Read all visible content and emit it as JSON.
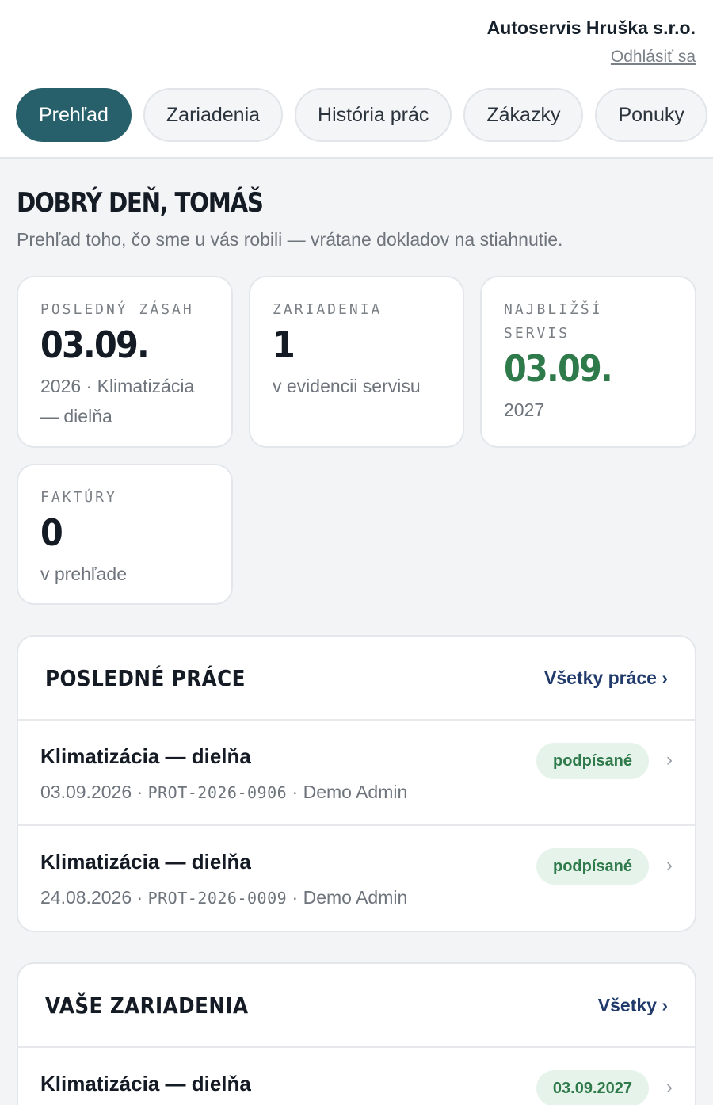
{
  "header": {
    "company": "Autoservis Hruška s.r.o.",
    "logout": "Odhlásiť sa"
  },
  "tabs": [
    {
      "label": "Prehľad",
      "active": true
    },
    {
      "label": "Zariadenia",
      "active": false
    },
    {
      "label": "História prác",
      "active": false
    },
    {
      "label": "Zákazky",
      "active": false
    },
    {
      "label": "Ponuky",
      "active": false
    }
  ],
  "greeting": {
    "title": "DOBRÝ DEŇ, TOMÁŠ",
    "subtitle": "Prehľad toho, čo sme u vás robili — vrátane dokladov na stiahnutie."
  },
  "stats": {
    "last": {
      "label": "POSLEDNÝ ZÁSAH",
      "value": "03.09.",
      "desc": "2026 · Klimatizácia — dielňa"
    },
    "devices": {
      "label": "ZARIADENIA",
      "value": "1",
      "desc": "v evidencii servisu"
    },
    "next": {
      "label": "NAJBLIŽŠÍ SERVIS",
      "value": "03.09.",
      "desc": "2027"
    },
    "invoices": {
      "label": "FAKTÚRY",
      "value": "0",
      "desc": "v prehľade"
    }
  },
  "recent_work": {
    "title": "POSLEDNÉ PRÁCE",
    "link": "Všetky práce ›",
    "rows": [
      {
        "title": "Klimatizácia — dielňa",
        "date": "03.09.2026",
        "code": "PROT-2026-0906",
        "person": "Demo Admin",
        "badge": "podpísané"
      },
      {
        "title": "Klimatizácia — dielňa",
        "date": "24.08.2026",
        "code": "PROT-2026-0009",
        "person": "Demo Admin",
        "badge": "podpísané"
      }
    ]
  },
  "devices_panel": {
    "title": "VAŠE ZARIADENIA",
    "link": "Všetky ›",
    "rows": [
      {
        "title": "Klimatizácia — dielňa",
        "badge": "03.09.2027"
      }
    ]
  },
  "sep": "·",
  "chevron": "›",
  "colors": {
    "accent": "#27606a",
    "green": "#2f7a4b",
    "badge_bg": "#e6f3ea",
    "link": "#1f3a6b"
  }
}
